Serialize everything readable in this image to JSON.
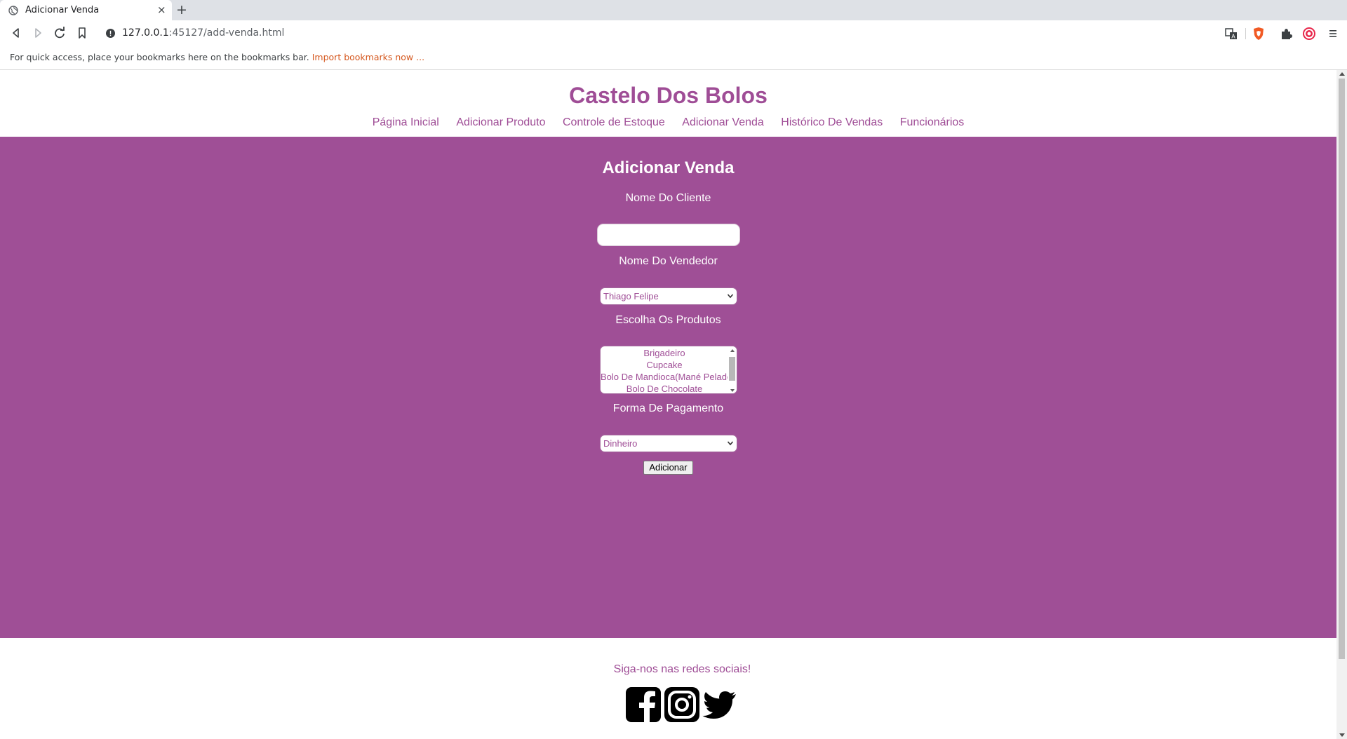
{
  "browser": {
    "tab_title": "Adicionar Venda",
    "tab_close": "×",
    "new_tab": "+",
    "url_host": "127.0.0.1",
    "url_rest": ":45127/add-venda.html",
    "bookmarks_message": "For quick access, place your bookmarks here on the bookmarks bar.",
    "bookmarks_link": "Import bookmarks now ..."
  },
  "site": {
    "title": "Castelo Dos Bolos",
    "nav": [
      "Página Inicial",
      "Adicionar Produto",
      "Controle de Estoque",
      "Adicionar Venda",
      "Histórico De Vendas",
      "Funcionários"
    ]
  },
  "form": {
    "heading": "Adicionar Venda",
    "client_label": "Nome Do Cliente",
    "client_value": "",
    "seller_label": "Nome Do Vendedor",
    "seller_selected": "Thiago Felipe",
    "products_label": "Escolha Os Produtos",
    "products_visible": [
      "Brigadeiro",
      "Cupcake",
      "Bolo De Mandioca(Mané Pelado)",
      "Bolo De Chocolate"
    ],
    "payment_label": "Forma De Pagamento",
    "payment_selected": "Dinheiro",
    "submit_label": "Adicionar"
  },
  "footer": {
    "follow_text": "Siga-nos nas redes sociais!",
    "social_icons": [
      "facebook-icon",
      "instagram-icon",
      "twitter-icon"
    ]
  },
  "colors": {
    "brand_purple": "#9f4d96",
    "content_bg": "#9f4f96"
  }
}
